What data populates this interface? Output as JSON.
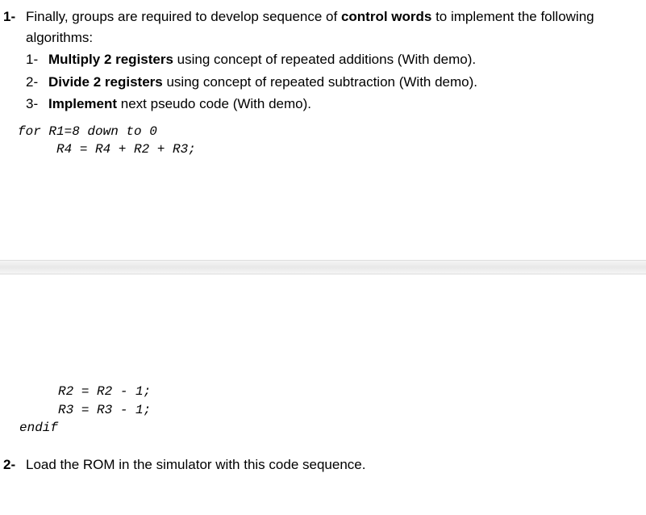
{
  "section1": {
    "marker": "1-",
    "intro_before": "Finally, groups are required to develop sequence of ",
    "intro_bold": "control words",
    "intro_after": " to implement the following algorithms:",
    "sub1": {
      "marker": "1-",
      "bold": "Multiply 2 registers",
      "rest": " using concept of repeated additions (With demo)."
    },
    "sub2": {
      "marker": "2-",
      "bold": "Divide 2 registers",
      "rest": " using concept of repeated subtraction (With demo)."
    },
    "sub3": {
      "marker": "3-",
      "bold": "Implement",
      "rest": " next pseudo code (With demo)."
    },
    "code_top": "for R1=8 down to 0\n     R4 = R4 + R2 + R3;",
    "code_bottom": "     R2 = R2 - 1;\n     R3 = R3 - 1;\nendif"
  },
  "section2": {
    "marker": "2-",
    "text": "Load the ROM in the simulator with this code sequence."
  }
}
